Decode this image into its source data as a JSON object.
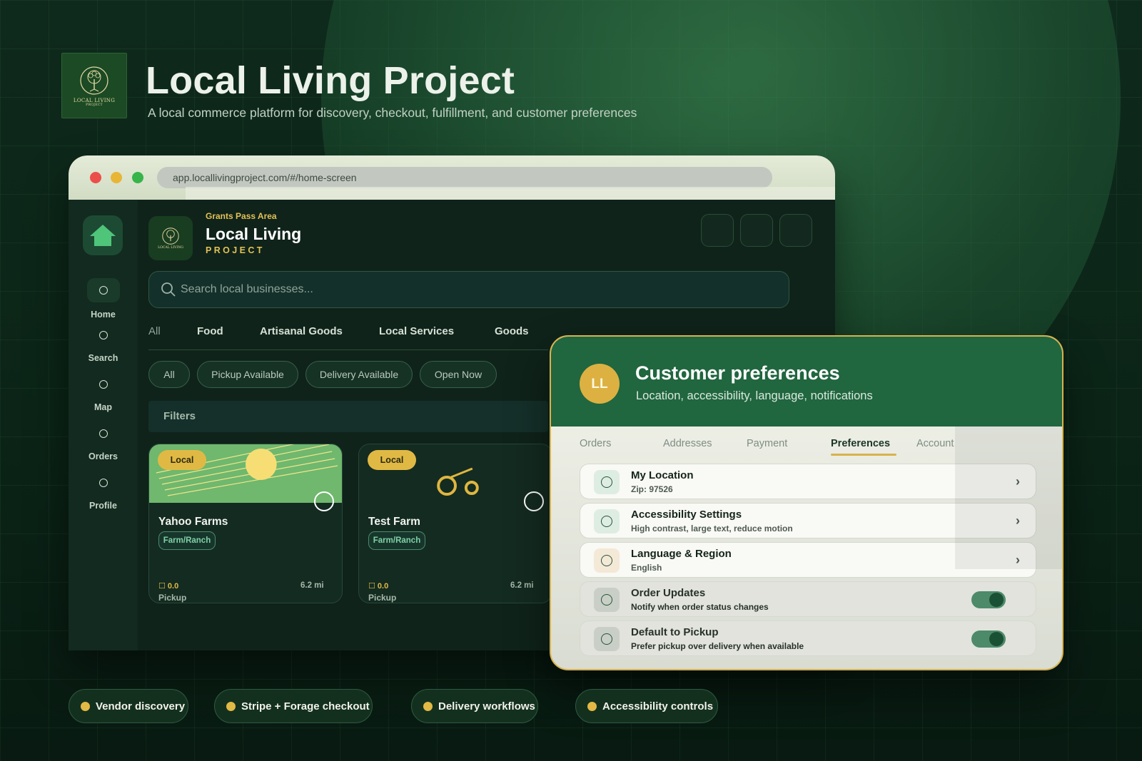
{
  "hero": {
    "title": "Local Living Project",
    "subtitle": "A local commerce platform for discovery, checkout, fulfillment, and customer preferences",
    "logo_text": "LOCAL LIVING",
    "logo_subtext": "PROJECT"
  },
  "browser": {
    "url": "app.locallivingproject.com/#/home-screen"
  },
  "app": {
    "area": "Grants Pass Area",
    "brand_line1": "Local Living",
    "brand_line2": "PROJECT",
    "logo_text": "LOCAL LIVING",
    "search_placeholder": "Search local businesses...",
    "sidebar": [
      {
        "label": "Home"
      },
      {
        "label": "Search"
      },
      {
        "label": "Map"
      },
      {
        "label": "Orders"
      },
      {
        "label": "Profile"
      }
    ],
    "categories": [
      "All",
      "Food",
      "Artisanal Goods",
      "Local Services",
      "Goods"
    ],
    "filter_pills": [
      "All",
      "Pickup Available",
      "Delivery Available",
      "Open Now"
    ],
    "filters_label": "Filters",
    "cards": [
      {
        "badge": "Local",
        "name": "Yahoo Farms",
        "tag": "Farm/Ranch",
        "rating": "☐ 0.0",
        "distance": "6.2 mi",
        "fulfillment": "Pickup"
      },
      {
        "badge": "Local",
        "name": "Test Farm",
        "tag": "Farm/Ranch",
        "rating": "☐ 0.0",
        "distance": "6.2 mi",
        "fulfillment": "Pickup"
      }
    ]
  },
  "preferences": {
    "avatar_initials": "LL",
    "title": "Customer preferences",
    "subtitle": "Location, accessibility, language, notifications",
    "tabs": [
      "Orders",
      "Addresses",
      "Payment",
      "Preferences",
      "Account"
    ],
    "active_tab": "Preferences",
    "rows": [
      {
        "title": "My Location",
        "subtitle": "Zip: 97526",
        "control": "chevron",
        "chevron": "›"
      },
      {
        "title": "Accessibility Settings",
        "subtitle": "High contrast, large text, reduce motion",
        "control": "chevron",
        "chevron": "›"
      },
      {
        "title": "Language & Region",
        "subtitle": "English",
        "control": "chevron",
        "chevron": "›"
      },
      {
        "title": "Order Updates",
        "subtitle": "Notify when order status changes",
        "control": "toggle",
        "toggle_on": true
      },
      {
        "title": "Default to Pickup",
        "subtitle": "Prefer pickup over delivery when available",
        "control": "toggle",
        "toggle_on": true
      }
    ]
  },
  "features": [
    "Vendor discovery",
    "Stripe + Forage checkout",
    "Delivery workflows",
    "Accessibility controls"
  ],
  "colors": {
    "accent_gold": "#e2b945",
    "brand_green": "#20663f",
    "background": "#0b2417"
  }
}
